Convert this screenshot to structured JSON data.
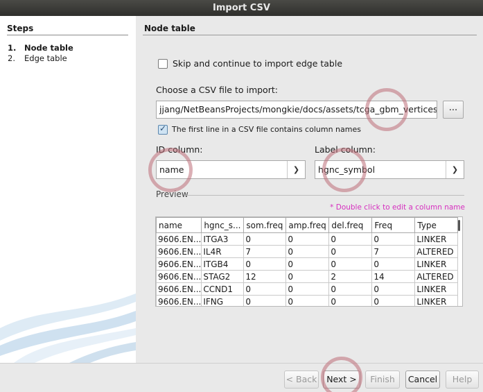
{
  "window": {
    "title": "Import CSV"
  },
  "sidebar": {
    "title": "Steps",
    "steps": [
      {
        "num": "1.",
        "label": "Node table"
      },
      {
        "num": "2.",
        "label": "Edge table"
      }
    ]
  },
  "main": {
    "title": "Node table",
    "skip_checkbox": {
      "label": "Skip and continue to import edge table",
      "checked": false
    },
    "file_prompt": "Choose a CSV file to import:",
    "file_path": "jjang/NetBeansProjects/mongkie/docs/assets/tcga_gbm_vertices.csv",
    "browse_label": "...",
    "header_checkbox": {
      "label": "The first line in a CSV file contains column names",
      "checked": true
    },
    "id_column": {
      "label": "ID column:",
      "value": "name"
    },
    "label_column": {
      "label": "Label column:",
      "value": "hgnc_symbol"
    },
    "preview": {
      "label": "Preview",
      "hint": "* Double click to edit a column name",
      "columns": [
        "name",
        "hgnc_s...",
        "som.freq",
        "amp.freq",
        "del.freq",
        "Freq",
        "Type"
      ],
      "rows": [
        [
          "9606.EN...",
          "ITGA3",
          "0",
          "0",
          "0",
          "0",
          "LINKER"
        ],
        [
          "9606.EN...",
          "IL4R",
          "7",
          "0",
          "0",
          "7",
          "ALTERED"
        ],
        [
          "9606.EN...",
          "ITGB4",
          "0",
          "0",
          "0",
          "0",
          "LINKER"
        ],
        [
          "9606.EN...",
          "STAG2",
          "12",
          "0",
          "2",
          "14",
          "ALTERED"
        ],
        [
          "9606.EN...",
          "CCND1",
          "0",
          "0",
          "0",
          "0",
          "LINKER"
        ],
        [
          "9606.EN...",
          "IFNG",
          "0",
          "0",
          "0",
          "0",
          "LINKER"
        ]
      ]
    }
  },
  "buttons": {
    "back": "< Back",
    "next": "Next >",
    "finish": "Finish",
    "cancel": "Cancel",
    "help": "Help"
  },
  "colors": {
    "hint": "#d62fbf",
    "annotation_circle": "#be6e78"
  }
}
